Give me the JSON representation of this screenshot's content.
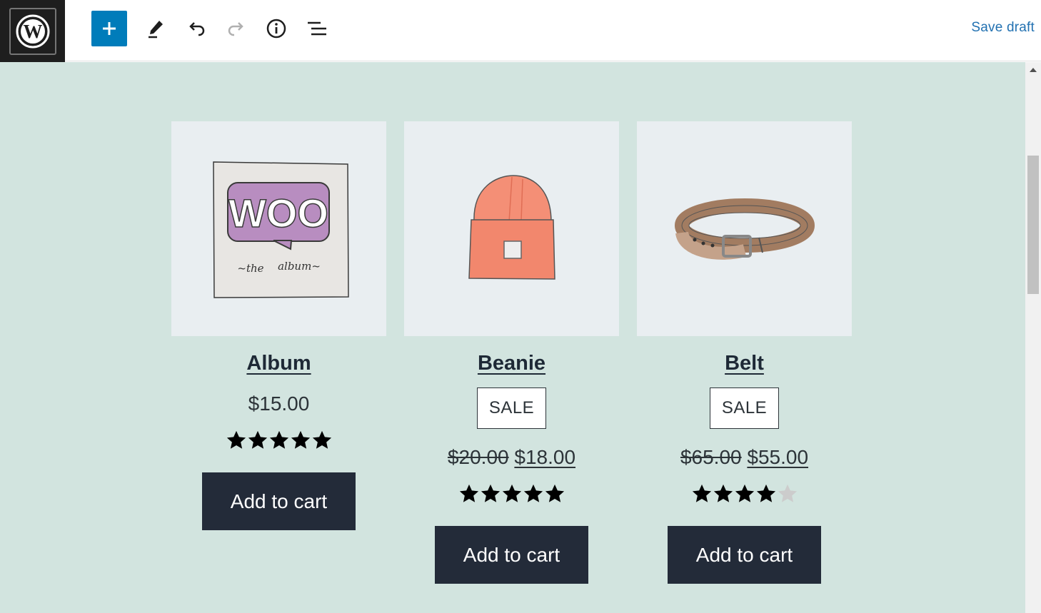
{
  "toolbar": {
    "save_label": "Save draft",
    "icons": [
      "wordpress-logo-icon",
      "plus-icon",
      "pencil-icon",
      "undo-icon",
      "redo-icon",
      "info-icon",
      "list-view-icon"
    ]
  },
  "colors": {
    "canvas_bg": "#d2e4df",
    "button_bg": "#232b39",
    "accent": "#007cba",
    "star_filled": "#000000",
    "star_empty": "#cccccc"
  },
  "products": [
    {
      "name": "Album",
      "sale": false,
      "price": "$15.00",
      "rating": 5,
      "cart_label": "Add to cart",
      "image_icon": "woo-album-icon"
    },
    {
      "name": "Beanie",
      "sale": true,
      "sale_label": "SALE",
      "old_price": "$20.00",
      "price": "$18.00",
      "rating": 5,
      "cart_label": "Add to cart",
      "image_icon": "beanie-icon"
    },
    {
      "name": "Belt",
      "sale": true,
      "sale_label": "SALE",
      "old_price": "$65.00",
      "price": "$55.00",
      "rating": 4,
      "cart_label": "Add to cart",
      "image_icon": "belt-icon"
    }
  ]
}
